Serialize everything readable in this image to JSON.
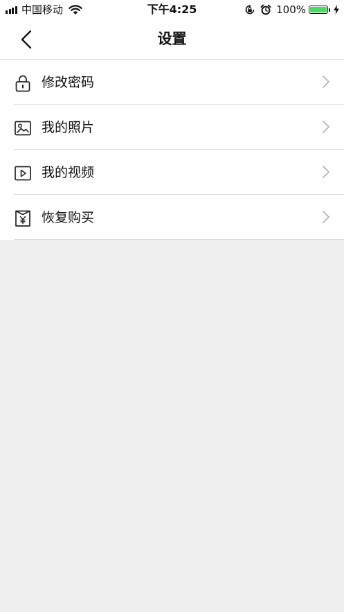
{
  "status_bar": {
    "carrier": "中国移动",
    "time": "下午4:25",
    "battery_percent": "100%",
    "battery_level": 1.0,
    "signal_bars": 4,
    "icons": [
      "signal-icon",
      "wifi-icon",
      "orientation-lock-icon",
      "alarm-icon",
      "battery-icon",
      "charging-icon"
    ]
  },
  "nav": {
    "back_icon": "chevron-left-icon",
    "title": "设置"
  },
  "menu": {
    "items": [
      {
        "label": "修改密码",
        "icon": "lock-icon"
      },
      {
        "label": "我的照片",
        "icon": "photo-icon"
      },
      {
        "label": "我的视频",
        "icon": "video-icon"
      },
      {
        "label": "恢复购买",
        "icon": "purchase-bag-icon"
      }
    ],
    "chevron_icon": "chevron-right-icon"
  },
  "colors": {
    "background": "#efeff0",
    "surface": "#ffffff",
    "divider": "#dcdcdc",
    "chevron": "#b4b4b4",
    "battery_fill": "#4cd964"
  }
}
